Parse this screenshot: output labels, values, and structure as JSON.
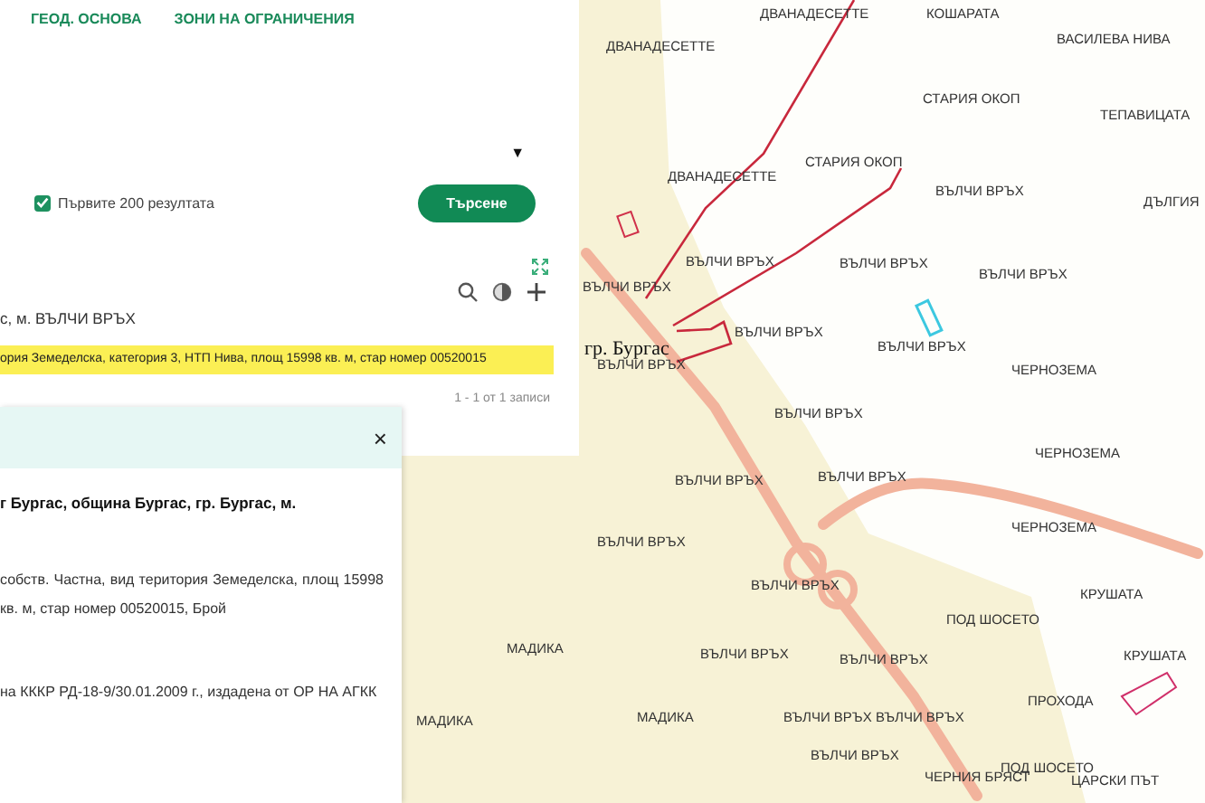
{
  "nav": {
    "tabs": [
      {
        "label": "ГЕОД. ОСНОВА",
        "selected": false
      },
      {
        "label": "ЗОНИ НА ОГРАНИЧЕНИЯ",
        "selected": false
      }
    ]
  },
  "search": {
    "dropdown_arrow": "▼",
    "first_200": {
      "label": "Първите 200 резултата",
      "checked": true
    },
    "button": "Търсене"
  },
  "results": {
    "location_line": "с, м. ВЪЛЧИ ВРЪХ",
    "highlighted_line": "ория Земеделска, категория 3, НТП Нива, площ 15998 кв. м, стар номер 00520015",
    "pager": "1 - 1 от 1 записи"
  },
  "details": {
    "close": "×",
    "title": "г Бургас, община Бургас, гр. Бургас, м.",
    "paragraphs": [
      "собств. Частна, вид територия Земеделска, площ 15998 кв. м, стар номер 00520015, Брой",
      "на КККР РД-18-9/30.01.2009 г., издадена от ОР НА АГКК"
    ]
  },
  "map": {
    "town": "гр. Бургас",
    "labels": [
      "ДВАНАДЕСЕТТЕ",
      "КОШАРАТА",
      "ВАСИЛЕВА НИВА",
      "ДВАНАДЕСЕТТЕ",
      "СТАРИЯ ОКОП",
      "ТЕПАВИЦАТА",
      "ДВАНАДЕСЕТТЕ",
      "СТАРИЯ ОКОП",
      "ВЪЛЧИ ВРЪХ",
      "ДЪЛГИЯ",
      "ВЪЛЧИ ВРЪХ",
      "ВЪЛЧИ ВРЪХ",
      "ВЪЛЧИ ВРЪХ",
      "ВЪЛЧИ ВРЪХ",
      "ВЪЛЧИ ВРЪХ",
      "ВЪЛЧИ ВРЪХ",
      "ВЪЛЧИ ВРЪХ",
      "ЧЕРНОЗЕМА",
      "ВЪЛЧИ ВРЪХ",
      "ЧЕРНОЗЕМА",
      "ВЪЛЧИ ВРЪХ",
      "ВЪЛЧИ ВРЪХ",
      "ВЪЛЧИ ВРЪХ",
      "ЧЕРНОЗЕМА",
      "ВЪЛЧИ ВРЪХ",
      "КРУШАТА",
      "ПОД ШОСЕТО",
      "ВЪЛЧИ ВРЪХ",
      "ВЪЛЧИ ВРЪХ",
      "КРУШАТА",
      "ПРОХОДА",
      "МАДИКА",
      "ВЪЛЧИ ВРЪХ",
      "ВЪЛЧИ ВРЪХ",
      "ВЪЛЧИ ВРЪХ",
      "ПОД ШОСЕТО",
      "ЧЕРНИЯ БРЯСТ",
      "ЦАРСКИ ПЪТ",
      "МАДИКА",
      "МАДИКА"
    ]
  }
}
